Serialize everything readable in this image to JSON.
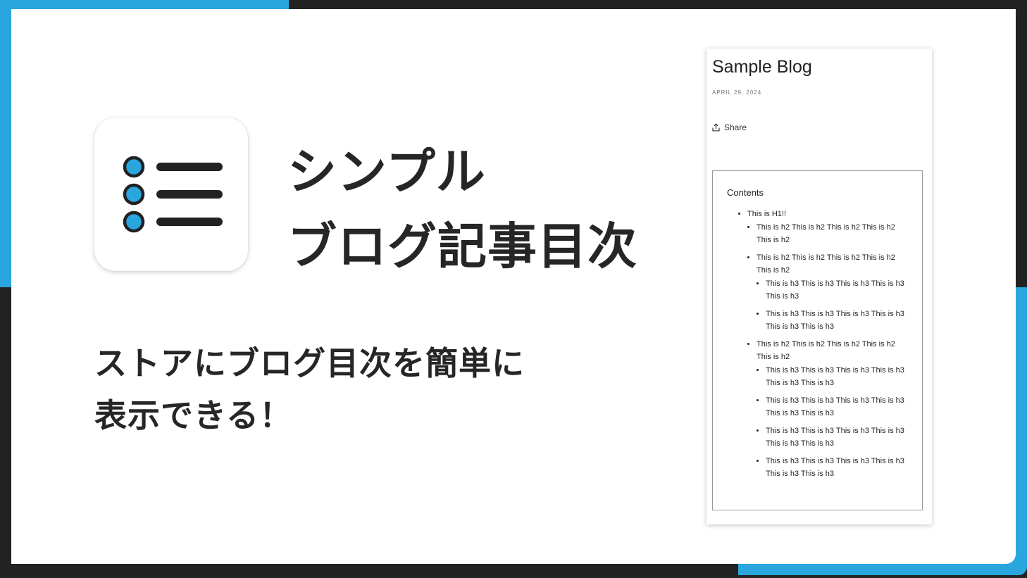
{
  "colors": {
    "accent_blue": "#2AA6DF",
    "frame_dark": "#222222",
    "text_dark": "#262626",
    "icon_dark": "#222222"
  },
  "app_icon": {
    "name": "list-icon"
  },
  "headline": {
    "line1": "シンプル",
    "line2": "ブログ記事目次"
  },
  "subheadline": {
    "line1": "ストアにブログ目次を簡単に",
    "line2": "表示できる！"
  },
  "blog_preview": {
    "title": "Sample Blog",
    "date": "APRIL 29, 2024",
    "share_icon": "share-icon",
    "share_label": "Share",
    "toc": {
      "heading": "Contents",
      "h1": "This is H1!!",
      "sections": [
        {
          "text": "This is h2 This is h2 This is h2 This is h2 This is h2",
          "children": []
        },
        {
          "text": "This is h2 This is h2 This is h2 This is h2 This is h2",
          "children": [
            "This is h3 This is h3 This is h3 This is h3 This is h3",
            "This is h3 This is h3 This is h3 This is h3 This is h3 This is h3"
          ]
        },
        {
          "text": "This is h2 This is h2 This is h2 This is h2 This is h2",
          "children": [
            "This is h3 This is h3 This is h3 This is h3 This is h3 This is h3",
            "This is h3 This is h3 This is h3 This is h3 This is h3 This is h3",
            "This is h3 This is h3 This is h3 This is h3 This is h3 This is h3",
            "This is h3 This is h3 This is h3 This is h3 This is h3 This is h3"
          ]
        }
      ]
    }
  }
}
